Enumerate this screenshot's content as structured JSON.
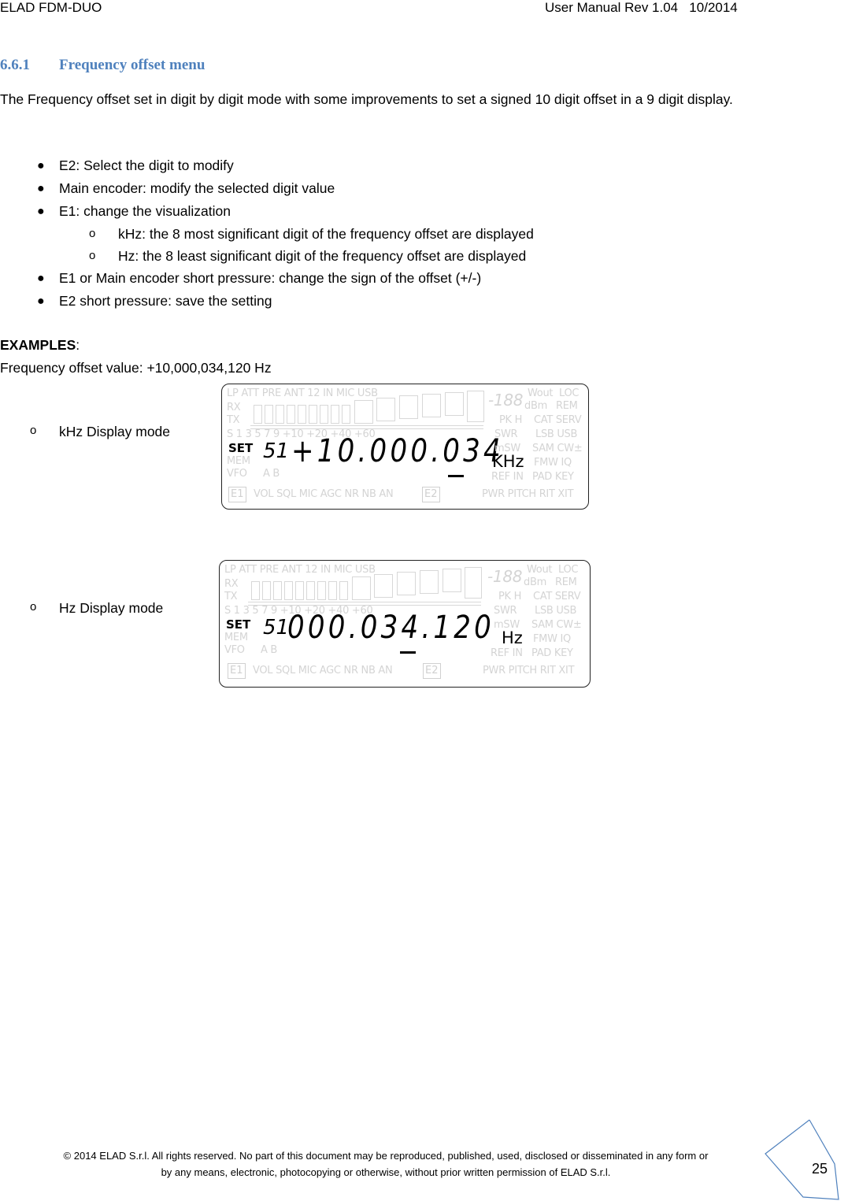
{
  "header": {
    "left": "ELAD FDM-DUO",
    "right": "User Manual Rev 1.04   10/2014"
  },
  "section": {
    "number": "6.6.1",
    "title": "Frequency offset menu"
  },
  "intro": "The Frequency offset set in digit by digit mode with some improvements to set a signed 10 digit offset in a 9 digit display.",
  "bullets": [
    {
      "text": "E2: Select the digit to modify"
    },
    {
      "text": "Main encoder: modify the selected digit value"
    },
    {
      "text": "E1: change the visualization",
      "sub": [
        "kHz: the 8 most significant digit of the frequency offset are displayed",
        "Hz: the 8 least significant digit of the frequency offset are displayed"
      ]
    },
    {
      "text": "E1 or Main encoder short pressure: change the sign of the offset (+/-)"
    },
    {
      "text": "E2 short pressure: save the setting"
    }
  ],
  "examples": {
    "heading": "EXAMPLES",
    "colon": ":",
    "value_line": "Frequency offset value: +10,000,034,120 Hz"
  },
  "displays": [
    {
      "label": "kHz Display mode",
      "set_text": "SET",
      "s_digits": "51",
      "digits": "+10.000.034",
      "unit": "KHz"
    },
    {
      "label": "Hz Display mode",
      "set_text": "SET",
      "s_digits": "51",
      "digits": "000.034.120",
      "unit": "Hz"
    }
  ],
  "lcd_ghost": {
    "top_row": "LP ATT PRE  ANT 12  IN MIC USB",
    "rx": "RX",
    "tx": "TX",
    "scale": "S    1     3     5     7     9 +10  +20          +40          +60",
    "mem": "MEM",
    "vfo": "VFO",
    "ab": "A  B",
    "right_col1": [
      "-188",
      "PK H",
      "SWR",
      "mSW",
      "",
      "REF IN"
    ],
    "right_wout": "Wout",
    "right_dbm": "dBm",
    "right_col2": [
      "LOC",
      "REM",
      "CAT SERV",
      "LSB USB",
      "SAM CW±",
      "FMW  IQ",
      "PAD KEY"
    ],
    "bottom": "VOL SQL MIC AGC NR NB AN",
    "bottom_right": "PWR PITCH RIT XIT",
    "e1": "E1",
    "e2": "E2"
  },
  "footer": {
    "line1": "© 2014 ELAD S.r.l. All rights reserved. No part of this document may be reproduced, published, used, disclosed or disseminated in any form or",
    "line2": "by any means, electronic, photocopying or otherwise, without prior written permission of ELAD S.r.l.",
    "page_number": "25"
  }
}
